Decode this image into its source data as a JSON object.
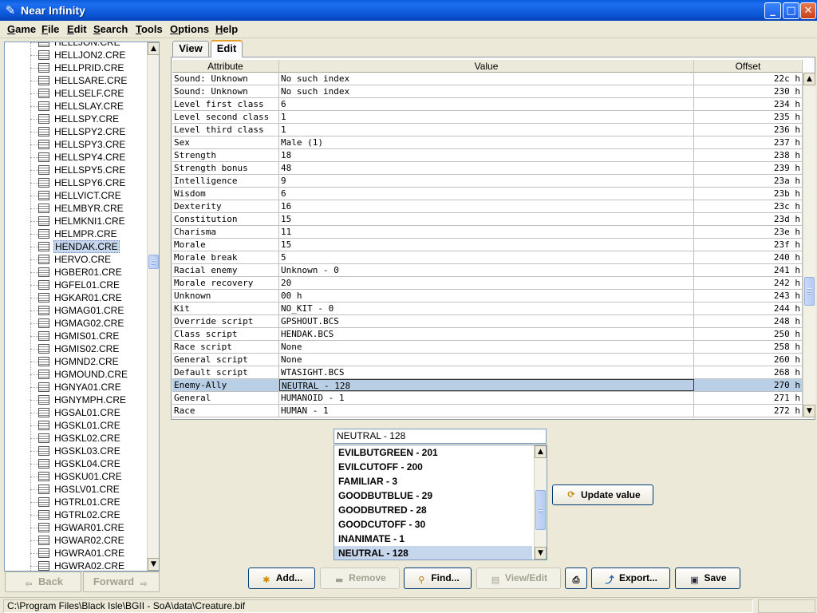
{
  "window": {
    "title": "Near Infinity"
  },
  "menu": [
    "Game",
    "File",
    "Edit",
    "Search",
    "Tools",
    "Options",
    "Help"
  ],
  "tree": {
    "items": [
      "HELLJON.CRE",
      "HELLJON2.CRE",
      "HELLPRID.CRE",
      "HELLSARE.CRE",
      "HELLSELF.CRE",
      "HELLSLAY.CRE",
      "HELLSPY.CRE",
      "HELLSPY2.CRE",
      "HELLSPY3.CRE",
      "HELLSPY4.CRE",
      "HELLSPY5.CRE",
      "HELLSPY6.CRE",
      "HELLVICT.CRE",
      "HELMBYR.CRE",
      "HELMKNI1.CRE",
      "HELMPR.CRE",
      "HENDAK.CRE",
      "HERVO.CRE",
      "HGBER01.CRE",
      "HGFEL01.CRE",
      "HGKAR01.CRE",
      "HGMAG01.CRE",
      "HGMAG02.CRE",
      "HGMIS01.CRE",
      "HGMIS02.CRE",
      "HGMND2.CRE",
      "HGMOUND.CRE",
      "HGNYA01.CRE",
      "HGNYMPH.CRE",
      "HGSAL01.CRE",
      "HGSKL01.CRE",
      "HGSKL02.CRE",
      "HGSKL03.CRE",
      "HGSKL04.CRE",
      "HGSKU01.CRE",
      "HGSLV01.CRE",
      "HGTRL01.CRE",
      "HGTRL02.CRE",
      "HGWAR01.CRE",
      "HGWAR02.CRE",
      "HGWRA01.CRE",
      "HGWRA02.CRE"
    ],
    "selected": "HENDAK.CRE"
  },
  "nav": {
    "back": "Back",
    "forward": "Forward"
  },
  "tabs": {
    "view": "View",
    "edit": "Edit"
  },
  "table": {
    "headers": {
      "attribute": "Attribute",
      "value": "Value",
      "offset": "Offset"
    },
    "rows": [
      [
        "Sound: Unknown",
        "No such index",
        "22c h"
      ],
      [
        "Sound: Unknown",
        "No such index",
        "230 h"
      ],
      [
        "Level first class",
        "6",
        "234 h"
      ],
      [
        "Level second class",
        "1",
        "235 h"
      ],
      [
        "Level third class",
        "1",
        "236 h"
      ],
      [
        "Sex",
        "Male (1)",
        "237 h"
      ],
      [
        "Strength",
        "18",
        "238 h"
      ],
      [
        "Strength bonus",
        "48",
        "239 h"
      ],
      [
        "Intelligence",
        "9",
        "23a h"
      ],
      [
        "Wisdom",
        "6",
        "23b h"
      ],
      [
        "Dexterity",
        "16",
        "23c h"
      ],
      [
        "Constitution",
        "15",
        "23d h"
      ],
      [
        "Charisma",
        "11",
        "23e h"
      ],
      [
        "Morale",
        "15",
        "23f h"
      ],
      [
        "Morale break",
        "5",
        "240 h"
      ],
      [
        "Racial enemy",
        "Unknown - 0",
        "241 h"
      ],
      [
        "Morale recovery",
        "20",
        "242 h"
      ],
      [
        "Unknown",
        "00 h",
        "243 h"
      ],
      [
        "Kit",
        "NO_KIT - 0",
        "244 h"
      ],
      [
        "Override script",
        "GPSHOUT.BCS",
        "248 h"
      ],
      [
        "Class script",
        "HENDAK.BCS",
        "250 h"
      ],
      [
        "Race script",
        "None",
        "258 h"
      ],
      [
        "General script",
        "None",
        "260 h"
      ],
      [
        "Default script",
        "WTASIGHT.BCS",
        "268 h"
      ],
      [
        "Enemy-Ally",
        "NEUTRAL - 128",
        "270 h"
      ],
      [
        "General",
        "HUMANOID - 1",
        "271 h"
      ],
      [
        "Race",
        "HUMAN - 1",
        "272 h"
      ]
    ],
    "selected_row": 24
  },
  "editor": {
    "current_value": "NEUTRAL - 128",
    "options": [
      "EVILBUTGREEN - 201",
      "EVILCUTOFF - 200",
      "FAMILIAR - 3",
      "GOODBUTBLUE - 29",
      "GOODBUTRED - 28",
      "GOODCUTOFF - 30",
      "INANIMATE - 1",
      "NEUTRAL - 128"
    ],
    "selected_option": 7,
    "update_button": "Update value"
  },
  "toolbar": {
    "add": "Add...",
    "remove": "Remove",
    "find": "Find...",
    "view_edit": "View/Edit",
    "export": "Export...",
    "save": "Save"
  },
  "status": {
    "path": "C:\\Program Files\\Black Isle\\BGII - SoA\\data\\Creature.bif"
  },
  "colors": {
    "titlebar": "#0b56d6",
    "selection": "#b8cfe5",
    "background": "#ece9d8"
  }
}
